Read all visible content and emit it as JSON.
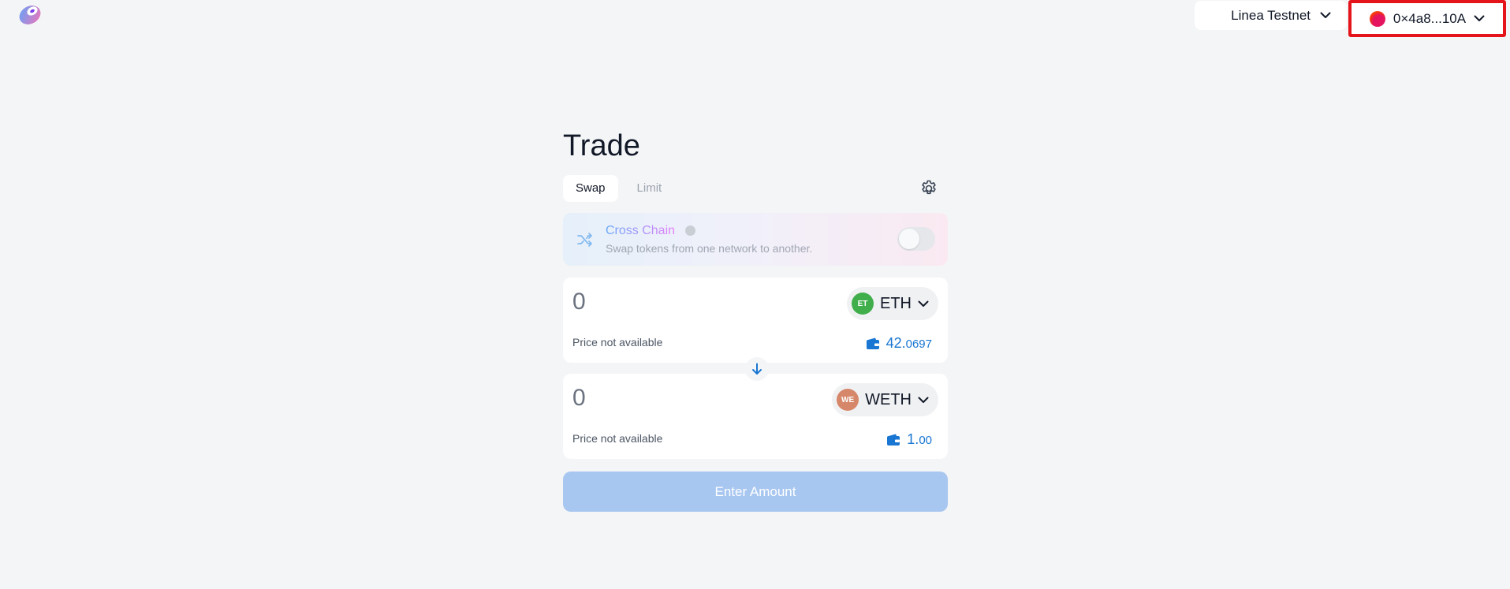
{
  "header": {
    "logo_icon": "sushi-logo-icon",
    "network_label": "Linea Testnet",
    "account_label": "0×4a8...10A",
    "accent_highlight": "#e5141b"
  },
  "trade": {
    "title": "Trade",
    "tabs": [
      {
        "label": "Swap",
        "active": true
      },
      {
        "label": "Limit",
        "active": false
      }
    ],
    "settings_icon": "gear-icon",
    "cross_chain": {
      "title": "Cross Chain",
      "subtitle": "Swap tokens from one network to another.",
      "enabled": false
    },
    "from": {
      "amount": "0",
      "token_symbol": "ETH",
      "token_icon_text": "ET",
      "token_icon_color": "#3fae4b",
      "price_text": "Price not available",
      "balance_main": "42.",
      "balance_decimals": "0697"
    },
    "to": {
      "amount": "0",
      "token_symbol": "WETH",
      "token_icon_text": "WE",
      "token_icon_color": "#d6876a",
      "price_text": "Price not available",
      "balance_main": "1.",
      "balance_decimals": "00"
    },
    "submit_label": "Enter Amount",
    "brand_blue": "#1976d2"
  }
}
